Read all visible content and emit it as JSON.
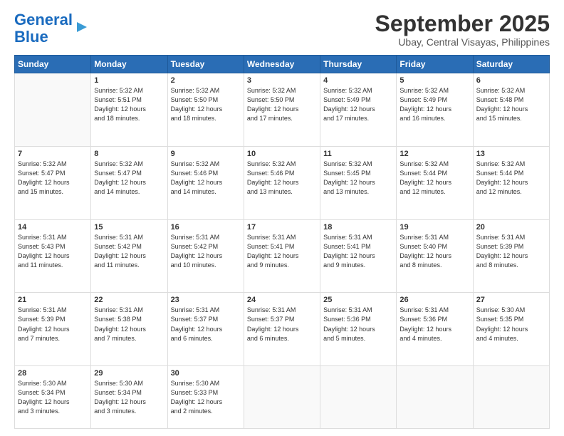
{
  "header": {
    "logo_line1": "General",
    "logo_line2": "Blue",
    "month": "September 2025",
    "location": "Ubay, Central Visayas, Philippines"
  },
  "weekdays": [
    "Sunday",
    "Monday",
    "Tuesday",
    "Wednesday",
    "Thursday",
    "Friday",
    "Saturday"
  ],
  "weeks": [
    [
      {
        "day": "",
        "info": ""
      },
      {
        "day": "1",
        "info": "Sunrise: 5:32 AM\nSunset: 5:51 PM\nDaylight: 12 hours\nand 18 minutes."
      },
      {
        "day": "2",
        "info": "Sunrise: 5:32 AM\nSunset: 5:50 PM\nDaylight: 12 hours\nand 18 minutes."
      },
      {
        "day": "3",
        "info": "Sunrise: 5:32 AM\nSunset: 5:50 PM\nDaylight: 12 hours\nand 17 minutes."
      },
      {
        "day": "4",
        "info": "Sunrise: 5:32 AM\nSunset: 5:49 PM\nDaylight: 12 hours\nand 17 minutes."
      },
      {
        "day": "5",
        "info": "Sunrise: 5:32 AM\nSunset: 5:49 PM\nDaylight: 12 hours\nand 16 minutes."
      },
      {
        "day": "6",
        "info": "Sunrise: 5:32 AM\nSunset: 5:48 PM\nDaylight: 12 hours\nand 15 minutes."
      }
    ],
    [
      {
        "day": "7",
        "info": "Sunrise: 5:32 AM\nSunset: 5:47 PM\nDaylight: 12 hours\nand 15 minutes."
      },
      {
        "day": "8",
        "info": "Sunrise: 5:32 AM\nSunset: 5:47 PM\nDaylight: 12 hours\nand 14 minutes."
      },
      {
        "day": "9",
        "info": "Sunrise: 5:32 AM\nSunset: 5:46 PM\nDaylight: 12 hours\nand 14 minutes."
      },
      {
        "day": "10",
        "info": "Sunrise: 5:32 AM\nSunset: 5:46 PM\nDaylight: 12 hours\nand 13 minutes."
      },
      {
        "day": "11",
        "info": "Sunrise: 5:32 AM\nSunset: 5:45 PM\nDaylight: 12 hours\nand 13 minutes."
      },
      {
        "day": "12",
        "info": "Sunrise: 5:32 AM\nSunset: 5:44 PM\nDaylight: 12 hours\nand 12 minutes."
      },
      {
        "day": "13",
        "info": "Sunrise: 5:32 AM\nSunset: 5:44 PM\nDaylight: 12 hours\nand 12 minutes."
      }
    ],
    [
      {
        "day": "14",
        "info": "Sunrise: 5:31 AM\nSunset: 5:43 PM\nDaylight: 12 hours\nand 11 minutes."
      },
      {
        "day": "15",
        "info": "Sunrise: 5:31 AM\nSunset: 5:42 PM\nDaylight: 12 hours\nand 11 minutes."
      },
      {
        "day": "16",
        "info": "Sunrise: 5:31 AM\nSunset: 5:42 PM\nDaylight: 12 hours\nand 10 minutes."
      },
      {
        "day": "17",
        "info": "Sunrise: 5:31 AM\nSunset: 5:41 PM\nDaylight: 12 hours\nand 9 minutes."
      },
      {
        "day": "18",
        "info": "Sunrise: 5:31 AM\nSunset: 5:41 PM\nDaylight: 12 hours\nand 9 minutes."
      },
      {
        "day": "19",
        "info": "Sunrise: 5:31 AM\nSunset: 5:40 PM\nDaylight: 12 hours\nand 8 minutes."
      },
      {
        "day": "20",
        "info": "Sunrise: 5:31 AM\nSunset: 5:39 PM\nDaylight: 12 hours\nand 8 minutes."
      }
    ],
    [
      {
        "day": "21",
        "info": "Sunrise: 5:31 AM\nSunset: 5:39 PM\nDaylight: 12 hours\nand 7 minutes."
      },
      {
        "day": "22",
        "info": "Sunrise: 5:31 AM\nSunset: 5:38 PM\nDaylight: 12 hours\nand 7 minutes."
      },
      {
        "day": "23",
        "info": "Sunrise: 5:31 AM\nSunset: 5:37 PM\nDaylight: 12 hours\nand 6 minutes."
      },
      {
        "day": "24",
        "info": "Sunrise: 5:31 AM\nSunset: 5:37 PM\nDaylight: 12 hours\nand 6 minutes."
      },
      {
        "day": "25",
        "info": "Sunrise: 5:31 AM\nSunset: 5:36 PM\nDaylight: 12 hours\nand 5 minutes."
      },
      {
        "day": "26",
        "info": "Sunrise: 5:31 AM\nSunset: 5:36 PM\nDaylight: 12 hours\nand 4 minutes."
      },
      {
        "day": "27",
        "info": "Sunrise: 5:30 AM\nSunset: 5:35 PM\nDaylight: 12 hours\nand 4 minutes."
      }
    ],
    [
      {
        "day": "28",
        "info": "Sunrise: 5:30 AM\nSunset: 5:34 PM\nDaylight: 12 hours\nand 3 minutes."
      },
      {
        "day": "29",
        "info": "Sunrise: 5:30 AM\nSunset: 5:34 PM\nDaylight: 12 hours\nand 3 minutes."
      },
      {
        "day": "30",
        "info": "Sunrise: 5:30 AM\nSunset: 5:33 PM\nDaylight: 12 hours\nand 2 minutes."
      },
      {
        "day": "",
        "info": ""
      },
      {
        "day": "",
        "info": ""
      },
      {
        "day": "",
        "info": ""
      },
      {
        "day": "",
        "info": ""
      }
    ]
  ]
}
